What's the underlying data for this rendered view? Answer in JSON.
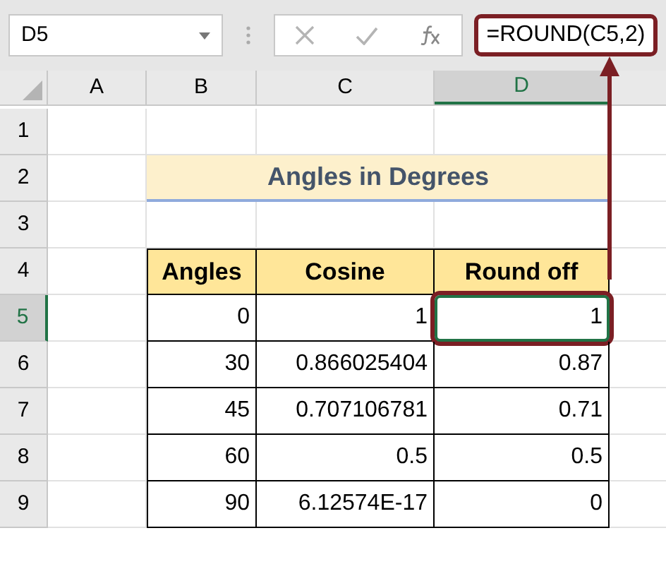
{
  "name_box": {
    "value": "D5"
  },
  "formula_bar": {
    "value": "=ROUND(C5,2)",
    "highlighted": true
  },
  "columns": [
    {
      "label": "A",
      "selected": false
    },
    {
      "label": "B",
      "selected": false
    },
    {
      "label": "C",
      "selected": false
    },
    {
      "label": "D",
      "selected": true
    }
  ],
  "rows": [
    {
      "label": "1",
      "selected": false
    },
    {
      "label": "2",
      "selected": false
    },
    {
      "label": "3",
      "selected": false
    },
    {
      "label": "4",
      "selected": false
    },
    {
      "label": "5",
      "selected": true
    },
    {
      "label": "6",
      "selected": false
    },
    {
      "label": "7",
      "selected": false
    },
    {
      "label": "8",
      "selected": false
    },
    {
      "label": "9",
      "selected": false
    }
  ],
  "title": "Angles in Degrees",
  "table": {
    "columns": [
      "Angles",
      "Cosine",
      "Round off"
    ],
    "rows": [
      {
        "cells": [
          "0",
          "1",
          "1"
        ],
        "highlighted": true
      },
      {
        "cells": [
          "30",
          "0.866025404",
          "0.87"
        ],
        "highlighted": false
      },
      {
        "cells": [
          "45",
          "0.707106781",
          "0.71"
        ],
        "highlighted": false
      },
      {
        "cells": [
          "60",
          "0.5",
          "0.5"
        ],
        "highlighted": false
      },
      {
        "cells": [
          "90",
          "6.12574E-17",
          "0"
        ],
        "highlighted": false
      }
    ]
  }
}
